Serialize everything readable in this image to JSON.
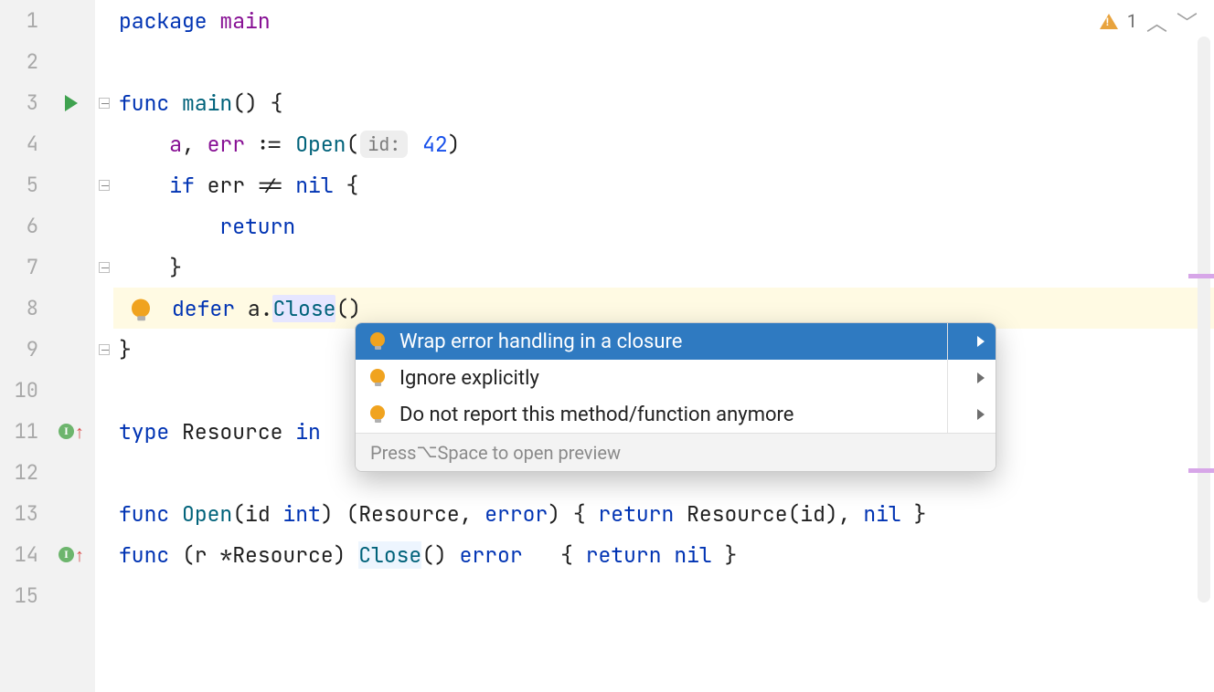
{
  "editor": {
    "line_numbers": [
      "1",
      "2",
      "3",
      "4",
      "5",
      "6",
      "7",
      "8",
      "9",
      "10",
      "11",
      "12",
      "13",
      "14",
      "15"
    ],
    "highlighted_line_index": 7,
    "code": {
      "l1_kw_package": "package",
      "l1_pkgname": "main",
      "l3_kw_func": "func",
      "l3_fn_main": "main",
      "l3_tail": "() {",
      "l4_indent": "    ",
      "l4_a": "a",
      "l4_sep1": ", ",
      "l4_err": "err",
      "l4_assign": " := ",
      "l4_open": "Open",
      "l4_lp": "(",
      "l4_hint": "id:",
      "l4_sp": " ",
      "l4_num": "42",
      "l4_rp": ")",
      "l5_indent": "    ",
      "l5_kw_if": "if",
      "l5_sp": " ",
      "l5_err": "err",
      "l5_cmp": " != ",
      "l5_nil": "nil",
      "l5_brace": " {",
      "l6_indent": "        ",
      "l6_return": "return",
      "l7_indent": "    ",
      "l7_brace": "}",
      "l8_indent": "    ",
      "l8_defer": "defer",
      "l8_sp": " ",
      "l8_a": "a",
      "l8_dot": ".",
      "l8_close": "Close",
      "l8_parens": "()",
      "l9_brace": "}",
      "l11_kw_type": "type",
      "l11_sp": " ",
      "l11_Resource": "Resource",
      "l11_sp2": " ",
      "l11_int_vis": "in",
      "l13_kw_func": "func",
      "l13_sp": " ",
      "l13_Open": "Open",
      "l13_sig1": "(id ",
      "l13_int": "int",
      "l13_sig2": ") (",
      "l13_Resource": "Resource",
      "l13_sig3": ", ",
      "l13_error": "error",
      "l13_sig4": ") { ",
      "l13_return": "return",
      "l13_sp2": " ",
      "l13_Resource2": "Resource",
      "l13_tail": "(id), ",
      "l13_nil": "nil",
      "l13_end": " }",
      "l14_kw_func": "func",
      "l14_recv": " (r *",
      "l14_Resource": "Resource",
      "l14_recv2": ") ",
      "l14_Close": "Close",
      "l14_sig": "() ",
      "l14_error": "error",
      "l14_pad": "   { ",
      "l14_return": "return",
      "l14_sp": " ",
      "l14_nil": "nil",
      "l14_end": " }"
    }
  },
  "inspection": {
    "warning_count": "1"
  },
  "intention_popup": {
    "items": [
      "Wrap error handling in a closure",
      "Ignore explicitly",
      "Do not report this method/function anymore"
    ],
    "selected_index": 0,
    "footer_prefix": "Press ",
    "footer_key": "⌥",
    "footer_suffix": "Space to open preview"
  },
  "icons": {
    "run": "run-triangle",
    "bulb": "lightbulb",
    "impl": "implements-up",
    "warn": "warning-triangle",
    "chev_up": "chevron-up",
    "chev_down": "chevron-down",
    "sub_arrow": "submenu-arrow"
  }
}
